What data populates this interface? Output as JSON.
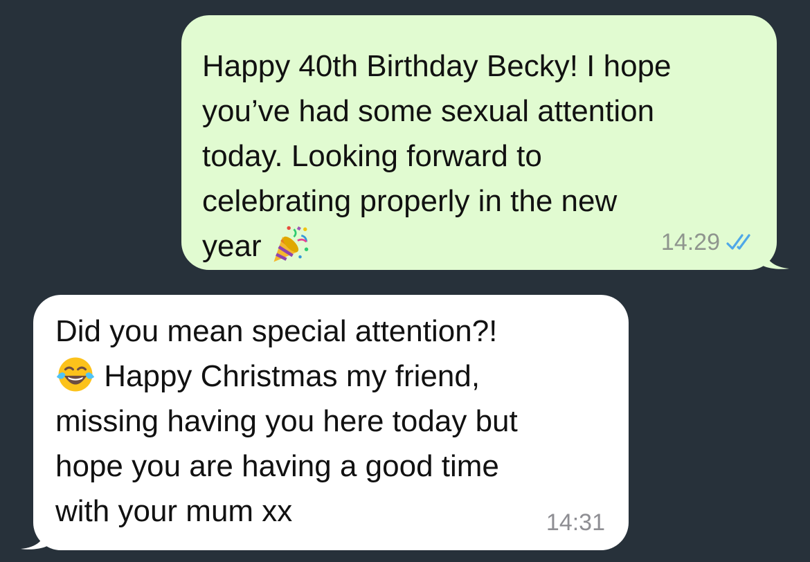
{
  "messages": [
    {
      "direction": "outgoing",
      "text": "Happy 40th Birthday Becky! I hope\nyou’ve had some sexual attention\ntoday. Looking forward to\ncelebrating properly in the new\nyear ",
      "emoji": "party-popper-icon",
      "time": "14:29",
      "status": "read"
    },
    {
      "direction": "incoming",
      "text_before_emoji": "Did you mean special attention?!\n",
      "emoji": "face-with-tears-of-joy-icon",
      "text_after_emoji": " Happy Christmas my friend,\nmissing having you here today but\nhope you are having a good time\nwith your mum xx",
      "time": "14:31"
    }
  ],
  "colors": {
    "background": "#27313a",
    "outgoing_bubble": "#e1fbd1",
    "incoming_bubble": "#ffffff",
    "read_ticks": "#4fa8e8",
    "timestamp": "#8f958e"
  }
}
